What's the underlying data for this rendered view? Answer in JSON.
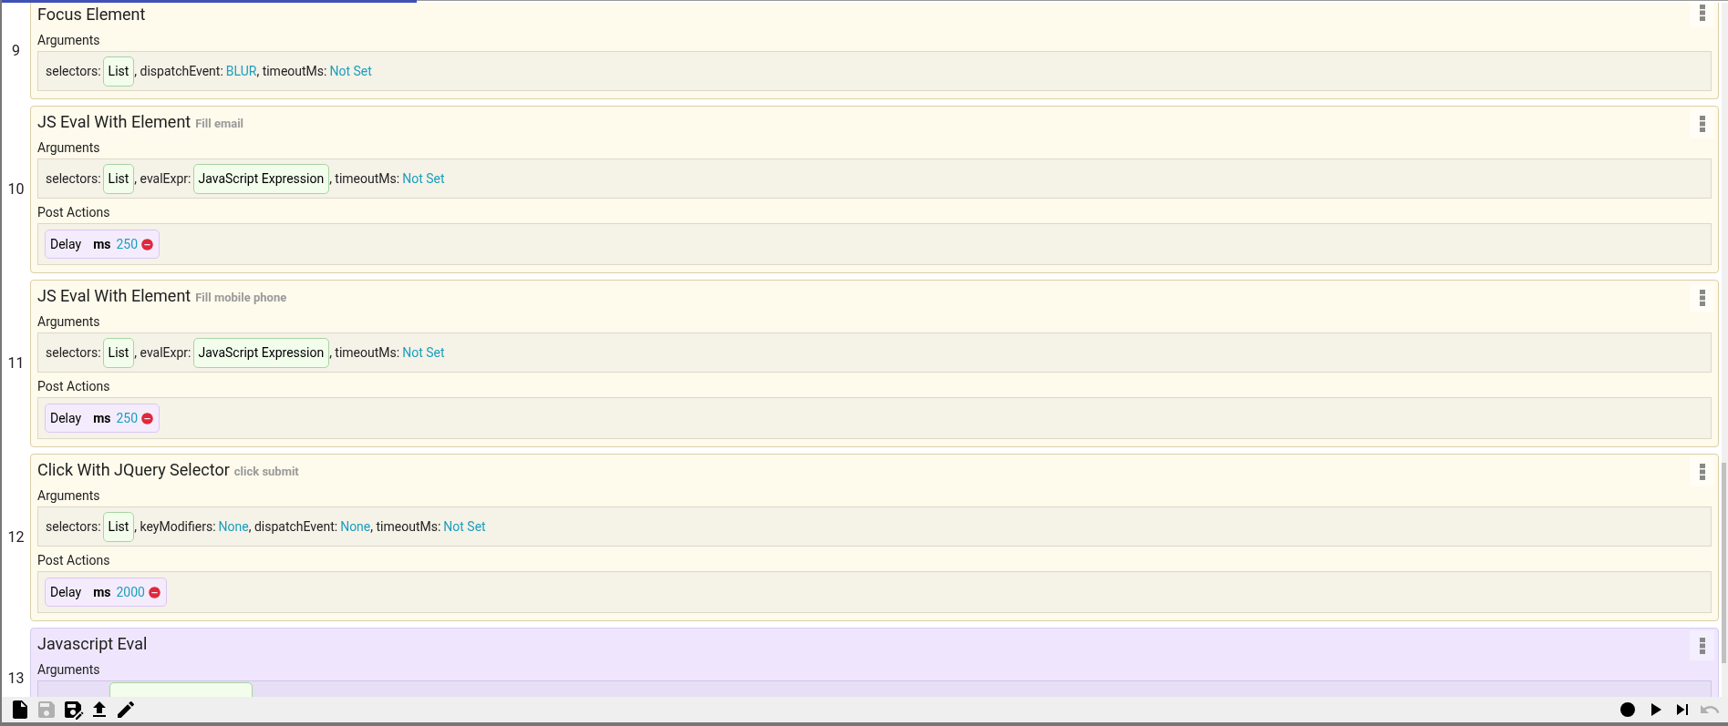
{
  "steps": [
    {
      "number": "9",
      "title": "Focus Element",
      "color": "#fefaec",
      "sections": [
        {
          "label": "Arguments",
          "kind": "arguments",
          "items": [
            {
              "name": "selectors:",
              "value": "List",
              "kind": "chip"
            },
            {
              "name": ", dispatchEvent:",
              "value": "BLUR",
              "kind": "value"
            },
            {
              "name": ", timeoutMs:",
              "value": "Not Set",
              "kind": "value"
            }
          ]
        }
      ]
    },
    {
      "number": "10",
      "title": "JS Eval With Element",
      "note": "Fill email",
      "color": "#fefaec",
      "sections": [
        {
          "label": "Arguments",
          "kind": "arguments",
          "items": [
            {
              "name": "selectors:",
              "value": "List",
              "kind": "chip"
            },
            {
              "name": ", evalExpr:",
              "value": "JavaScript Expression",
              "kind": "chip"
            },
            {
              "name": ", timeoutMs:",
              "value": "Not Set",
              "kind": "value"
            }
          ]
        },
        {
          "label": "Post Actions",
          "kind": "actions",
          "items": [
            {
              "name": "Delay",
              "key": "ms",
              "value": "250"
            }
          ]
        }
      ]
    },
    {
      "number": "11",
      "title": "JS Eval With Element",
      "note": "Fill mobile phone",
      "color": "#fefaec",
      "sections": [
        {
          "label": "Arguments",
          "kind": "arguments",
          "items": [
            {
              "name": "selectors:",
              "value": "List",
              "kind": "chip"
            },
            {
              "name": ", evalExpr:",
              "value": "JavaScript Expression",
              "kind": "chip"
            },
            {
              "name": ", timeoutMs:",
              "value": "Not Set",
              "kind": "value"
            }
          ]
        },
        {
          "label": "Post Actions",
          "kind": "actions",
          "items": [
            {
              "name": "Delay",
              "key": "ms",
              "value": "250"
            }
          ]
        }
      ]
    },
    {
      "number": "12",
      "title": "Click With JQuery Selector",
      "note": "click submit",
      "color": "#fefaec",
      "sections": [
        {
          "label": "Arguments",
          "kind": "arguments",
          "items": [
            {
              "name": "selectors:",
              "value": "List",
              "kind": "chip"
            },
            {
              "name": ", keyModifiers:",
              "value": "None",
              "kind": "value"
            },
            {
              "name": ", dispatchEvent:",
              "value": "None",
              "kind": "value"
            },
            {
              "name": ", timeoutMs:",
              "value": "Not Set",
              "kind": "value"
            }
          ]
        },
        {
          "label": "Post Actions",
          "kind": "actions",
          "items": [
            {
              "name": "Delay",
              "key": "ms",
              "value": "2000"
            }
          ]
        }
      ]
    },
    {
      "number": "13",
      "title": "Javascript Eval",
      "color": "#efe6fd",
      "sections": [
        {
          "label": "Arguments",
          "kind": "arguments",
          "items": [
            {
              "kind": "hidden_chip"
            }
          ]
        }
      ]
    }
  ],
  "toolbar": {
    "left": [
      {
        "kind": "new",
        "disabled": false
      },
      {
        "kind": "save",
        "disabled": true
      },
      {
        "kind": "save_as",
        "disabled": false
      },
      {
        "kind": "upload",
        "disabled": false
      },
      {
        "kind": "edit",
        "disabled": false
      }
    ],
    "right": [
      {
        "kind": "record",
        "disabled": false
      },
      {
        "kind": "play",
        "disabled": false
      },
      {
        "kind": "step",
        "disabled": false
      },
      {
        "kind": "undo",
        "disabled": true
      }
    ]
  }
}
